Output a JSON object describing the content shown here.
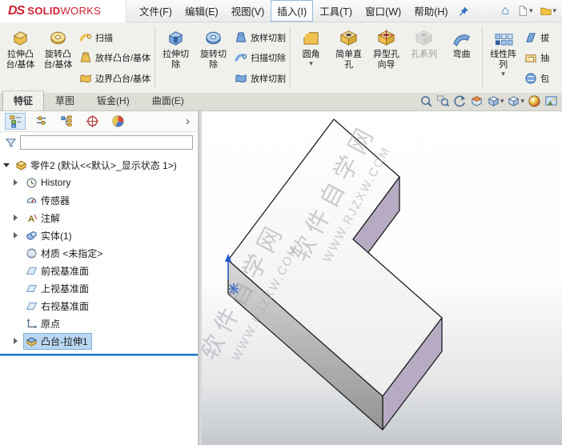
{
  "menubar": {
    "logo_ds": "DS",
    "brand_solid": "SOLID",
    "brand_works": "WORKS",
    "items": [
      "文件(F)",
      "编辑(E)",
      "视图(V)",
      "插入(I)",
      "工具(T)",
      "窗口(W)",
      "帮助(H)"
    ]
  },
  "icons": {
    "dropdown": "▾",
    "chevron_right": "›",
    "home": "⌂"
  },
  "ribbon": {
    "extrude_boss": "拉伸凸台/基体",
    "revolve_boss": "旋转凸台/基体",
    "swept_boss": "扫描",
    "loft_boss": "放样凸台/基体",
    "boundary_boss": "边界凸台/基体",
    "extrude_cut": "拉伸切除",
    "revolve_cut": "旋转切除",
    "loft_cut": "放样切割",
    "swept_cut": "扫描切除",
    "boundary_cut": "放样切割",
    "fillet": "圆角",
    "simple_hole": "简单直孔",
    "hole_wizard": "异型孔向导",
    "hole_series": "孔系列",
    "flex": "弯曲",
    "linear_pattern": "线性阵列",
    "draft": "拔",
    "shell": "抽",
    "wrap": "包"
  },
  "tabs": {
    "items": [
      "特征",
      "草图",
      "钣金(H)",
      "曲面(E)"
    ],
    "active": "特征"
  },
  "sidebar": {
    "tree": [
      {
        "label": "零件2 (默认<<默认>_显示状态 1>)"
      },
      {
        "label": "History"
      },
      {
        "label": "传感器"
      },
      {
        "label": "注解"
      },
      {
        "label": "实体(1)"
      },
      {
        "label": "材质 <未指定>"
      },
      {
        "label": "前视基准面"
      },
      {
        "label": "上视基准面"
      },
      {
        "label": "右视基准面"
      },
      {
        "label": "原点"
      },
      {
        "label": "凸台-拉伸1"
      }
    ]
  },
  "viewport": {
    "watermark_line1": "软件自学网",
    "watermark_line2": "WWW.RJZXW.COM"
  },
  "colors": {
    "logo_red": "#cf2030",
    "selection_blue": "#b9d7f1",
    "rollback_blue": "#1473cc",
    "part_top_face": "#fbfbfb",
    "part_front_face": "#a9a9a9",
    "part_side_face": "#b6abc2"
  }
}
